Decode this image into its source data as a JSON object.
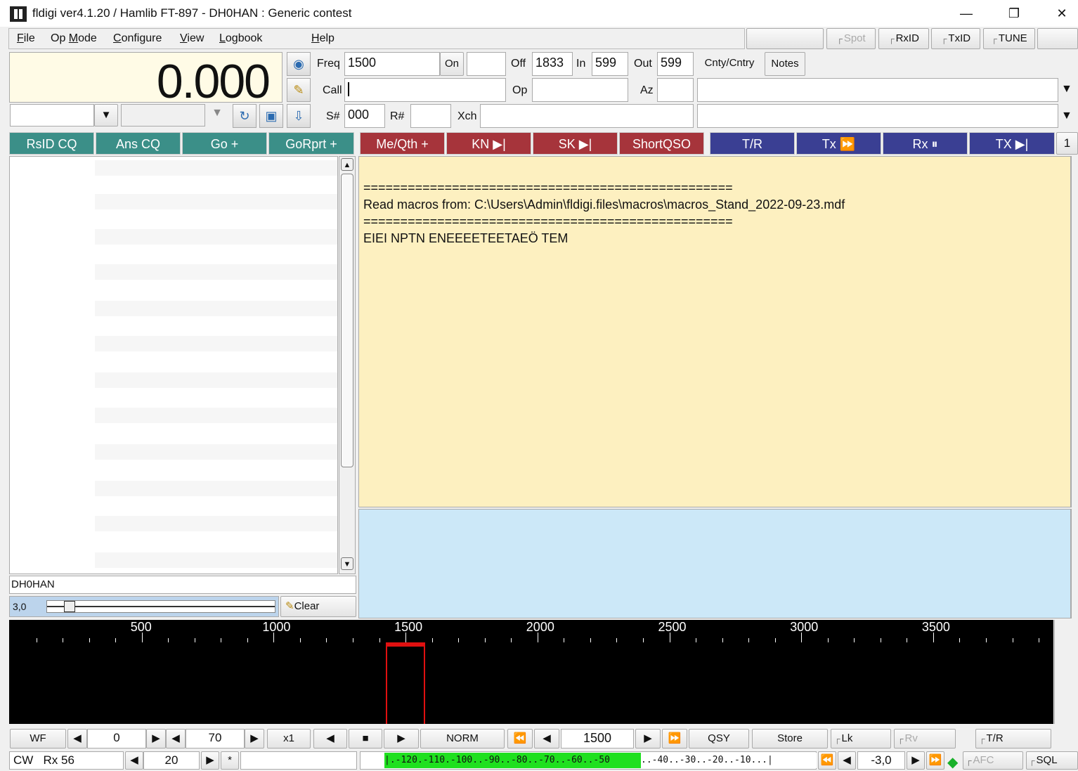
{
  "window": {
    "title": "fldigi ver4.1.20 / Hamlib FT-897 - DH0HAN : Generic contest"
  },
  "menu": [
    {
      "pre": "",
      "ul": "F",
      "post": "ile"
    },
    {
      "pre": "Op ",
      "ul": "M",
      "post": "ode"
    },
    {
      "pre": "",
      "ul": "C",
      "post": "onfigure"
    },
    {
      "pre": "",
      "ul": "V",
      "post": "iew"
    },
    {
      "pre": "",
      "ul": "L",
      "post": "ogbook"
    },
    {
      "pre": "",
      "ul": "H",
      "post": "elp"
    }
  ],
  "topright": {
    "spot": "Spot",
    "rxid": "RxID",
    "txid": "TxID",
    "tune": "TUNE"
  },
  "freq_display": "0.000",
  "log": {
    "freq_label": "Freq",
    "freq": "1500",
    "on_label": "On",
    "on": "",
    "off_label": "Off",
    "off": "1833",
    "in_label": "In",
    "in": "599",
    "out_label": "Out",
    "out": "599",
    "cnty_label": "Cnty/Cntry",
    "notes_label": "Notes",
    "call_label": "Call",
    "call": "",
    "op_label": "Op",
    "op": "",
    "az_label": "Az",
    "az": "",
    "snum_label": "S#",
    "snum": "000",
    "rnum_label": "R#",
    "rnum": "",
    "xch_label": "Xch",
    "xch": ""
  },
  "macros": [
    {
      "label": "RsID CQ",
      "color": "teal"
    },
    {
      "label": "Ans CQ",
      "color": "teal"
    },
    {
      "label": "Go +",
      "color": "teal"
    },
    {
      "label": "GoRprt +",
      "color": "teal"
    },
    {
      "label": "Me/Qth +",
      "color": "red"
    },
    {
      "label": "KN ▶|",
      "color": "red"
    },
    {
      "label": "SK ▶|",
      "color": "red"
    },
    {
      "label": "ShortQSO",
      "color": "red"
    },
    {
      "label": "T/R",
      "color": "blue"
    },
    {
      "label": "Tx ⏩",
      "color": "blue"
    },
    {
      "label": "Rx ⏸",
      "color": "blue"
    },
    {
      "label": "TX ▶|",
      "color": "blue"
    }
  ],
  "macro_page": "1",
  "rx_text": [
    "==================================================",
    "Read macros from: C:\\Users\\Admin\\fldigi.files\\macros\\macros_Stand_2022-09-23.mdf",
    "==================================================",
    "EIEI NPTN ENEEEETEETAEÖ TEM"
  ],
  "left_footer": {
    "callsign": "DH0HAN",
    "scale": "3,0",
    "clear": "Clear"
  },
  "waterfall": {
    "scale_labels": [
      "500",
      "1000",
      "1500",
      "2000",
      "2500",
      "3000",
      "3500"
    ],
    "marker_hz": 1500
  },
  "controls": {
    "wf": "WF",
    "offset": "0",
    "range": "70",
    "zoom": "x1",
    "speed": "NORM",
    "carrier": "1500",
    "qsy": "QSY",
    "store": "Store",
    "lk": "Lk",
    "rv": "Rv",
    "tr": "T/R"
  },
  "status": {
    "mode": "CW",
    "rx": "Rx 56",
    "wpm": "20",
    "star": "*",
    "signal_green": "|.-120.-110.-100..-90..-80..-70..-60..-50",
    "signal_white": "..-40..-30..-20..-10...|",
    "sq": "-3,0",
    "afc": "AFC",
    "sql": "SQL"
  }
}
